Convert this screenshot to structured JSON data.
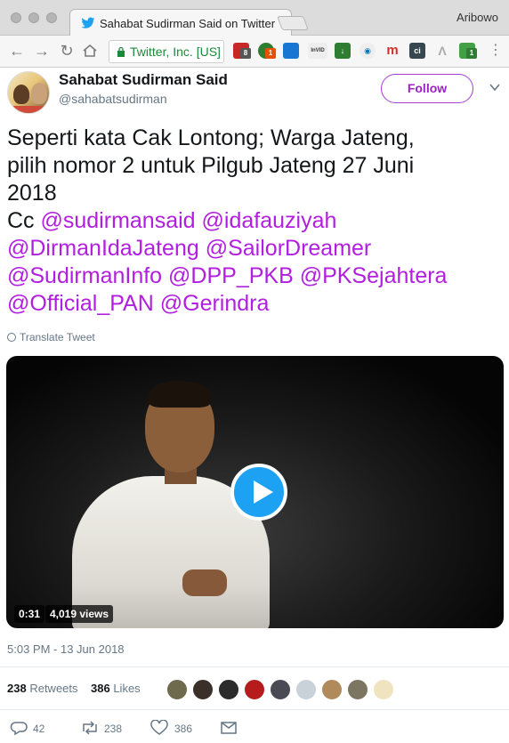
{
  "browser": {
    "tab_title": "Sahabat Sudirman Said on Twitter",
    "profile_name": "Aribowo",
    "url_text": "Twitter, Inc. [US]",
    "extension_badges": [
      "8",
      "1",
      "1"
    ],
    "extension_labels": [
      "InVID",
      "m",
      "c",
      "ci"
    ]
  },
  "tweet": {
    "display_name": "Sahabat Sudirman Said",
    "handle": "@sahabatsudirman",
    "follow_label": "Follow",
    "text_line1": "Seperti kata Cak Lontong; Warga Jateng,",
    "text_line2": "pilih nomor 2 untuk Pilgub Jateng 27 Juni",
    "text_line3": "2018",
    "cc_label": "Cc ",
    "mention_sudirmansaid": "@sudirmansaid",
    "mention_idafauziyah": "@idafauziyah",
    "mention_dirmanidajateng": "@DirmanIdaJateng",
    "mention_sailordreamer": "@SailorDreamer",
    "mention_sudirmaninfo": "@SudirmanInfo",
    "mention_dpp_pkb": "@DPP_PKB",
    "mention_pksejahtera": "@PKSejahtera",
    "mention_official_pan": "@Official_PAN",
    "mention_gerindra": "@Gerindra",
    "translate_label": "Translate Tweet",
    "video": {
      "duration": "0:31",
      "views": "4,019 views"
    },
    "timestamp": "5:03 PM - 13 Jun 2018",
    "stats": {
      "retweets_count": "238",
      "retweets_label": "Retweets",
      "likes_count": "386",
      "likes_label": "Likes"
    },
    "actions": {
      "replies": "42",
      "retweets": "238",
      "likes": "386"
    }
  },
  "colors": {
    "accent_purple": "#b21ee0",
    "follow_border": "#ab3bd1",
    "play_blue": "#1da1f2",
    "muted_text": "#657786"
  },
  "icons": [
    "twitter-bird-icon",
    "back-icon",
    "forward-icon",
    "reload-icon",
    "home-icon",
    "lock-icon",
    "chevron-down-icon",
    "globe-icon",
    "play-icon",
    "reply-icon",
    "retweet-icon",
    "like-icon",
    "mail-icon"
  ]
}
